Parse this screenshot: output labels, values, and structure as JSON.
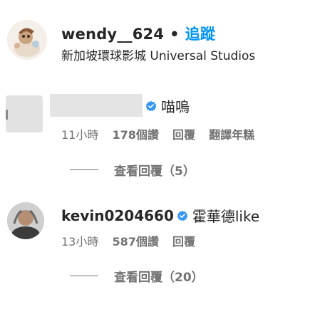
{
  "post": {
    "username": "wendy__624",
    "separator": "•",
    "follow_label": "追蹤",
    "location": "新加坡環球影城 Universal Studios"
  },
  "comments": [
    {
      "username": "",
      "verified": true,
      "text": "喵嗚",
      "time": "11小時",
      "likes": "178個讚",
      "reply_label": "回覆",
      "translate_label": "翻譯年糕",
      "view_replies_label": "查看回覆（5）"
    },
    {
      "username": "kevin0204660",
      "verified": true,
      "text": "霍華德like",
      "time": "13小時",
      "likes": "587個讚",
      "reply_label": "回覆",
      "view_replies_label": "查看回覆（20）"
    }
  ],
  "colors": {
    "text": "#262626",
    "secondary": "#737373",
    "link": "#0095f6",
    "verified": "#3897f0"
  },
  "icons": {
    "verified": "verified-badge-icon"
  }
}
